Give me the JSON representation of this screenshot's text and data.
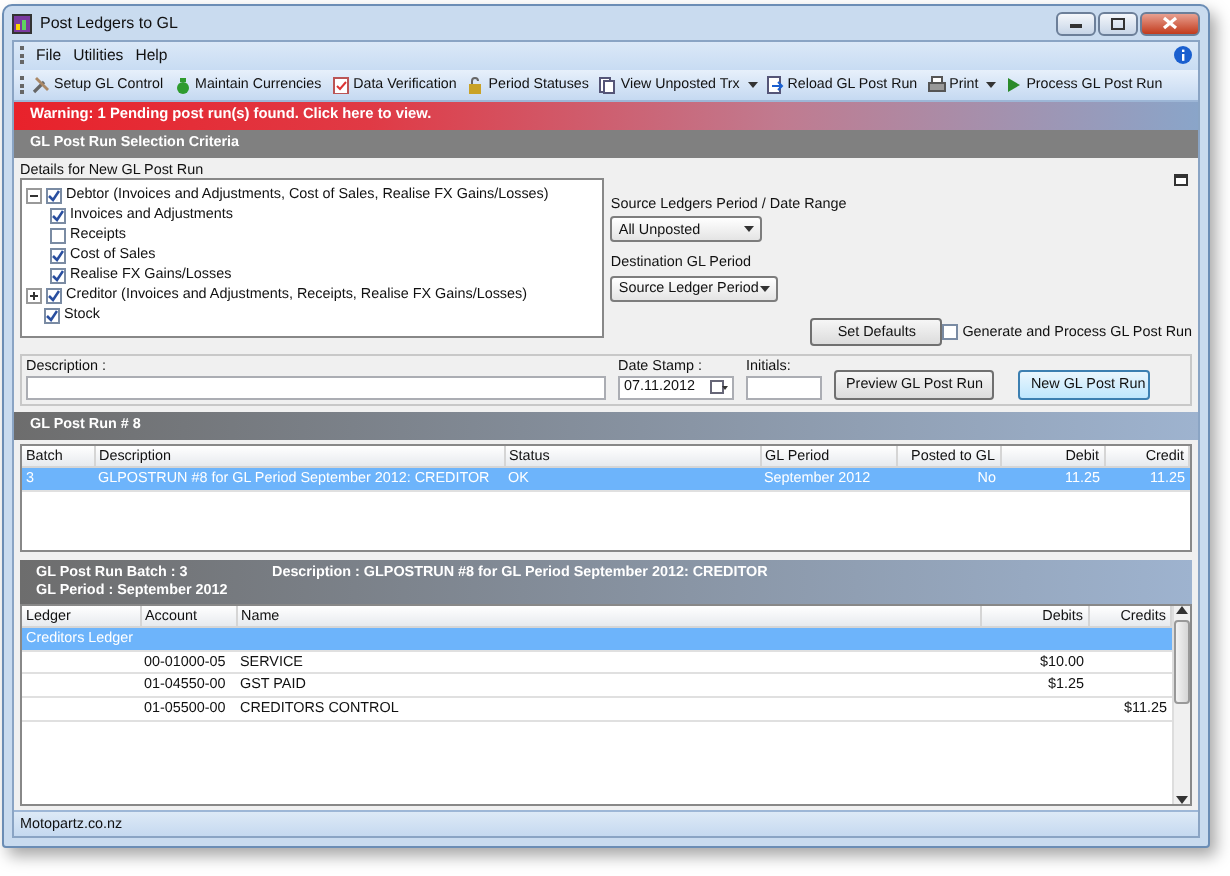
{
  "window": {
    "title": "Post Ledgers to GL"
  },
  "menu": [
    "File",
    "Utilities",
    "Help"
  ],
  "toolbar": [
    {
      "label": "Setup GL Control",
      "dropdown": false
    },
    {
      "label": "Maintain Currencies",
      "dropdown": false
    },
    {
      "label": "Data Verification",
      "dropdown": false
    },
    {
      "label": "Period Statuses",
      "dropdown": false
    },
    {
      "label": "View Unposted Trx",
      "dropdown": true
    },
    {
      "label": "Reload GL Post Run",
      "dropdown": false
    },
    {
      "label": "Print",
      "dropdown": true
    },
    {
      "label": "Process GL Post Run",
      "dropdown": false
    }
  ],
  "warning": "Warning: 1 Pending post run(s) found. Click here to view.",
  "selection_criteria": {
    "title": "GL Post Run Selection Criteria",
    "subtitle": "Details for New GL Post Run",
    "tree": [
      {
        "label": "Debtor (Invoices and Adjustments, Cost of Sales, Realise FX Gains/Losses)",
        "checked": true,
        "expanded": true,
        "children": [
          {
            "label": "Invoices and Adjustments",
            "checked": true
          },
          {
            "label": "Receipts",
            "checked": false
          },
          {
            "label": "Cost of Sales",
            "checked": true
          },
          {
            "label": "Realise FX Gains/Losses",
            "checked": true
          }
        ]
      },
      {
        "label": "Creditor (Invoices and Adjustments, Receipts, Realise FX Gains/Losses)",
        "checked": true,
        "expanded": false
      },
      {
        "label": "Stock",
        "checked": true
      }
    ],
    "source_period": {
      "label": "Source Ledgers Period / Date Range",
      "value": "All Unposted"
    },
    "destination_period": {
      "label": "Destination GL Period",
      "value": "Source Ledger Period"
    },
    "set_defaults": "Set Defaults",
    "generate": {
      "label": "Generate and Process GL Post Run",
      "checked": false
    },
    "description": {
      "label": "Description :"
    },
    "date_stamp": {
      "label": "Date Stamp :",
      "value": "07.11.2012"
    },
    "initials": {
      "label": "Initials:"
    },
    "preview_button": "Preview GL Post Run",
    "new_button": "New GL Post Run"
  },
  "post_run": {
    "title": "GL Post Run # 8",
    "columns": [
      "Batch",
      "Description",
      "Status",
      "GL Period",
      "Posted to GL",
      "Debit",
      "Credit"
    ],
    "rows": [
      {
        "selected": true,
        "cells": [
          "3",
          "GLPOSTRUN #8 for GL Period September 2012: CREDITOR",
          "OK",
          "September 2012",
          "No",
          "11.25",
          "11.25"
        ]
      }
    ]
  },
  "batch": {
    "batch_label": "GL Post Run Batch : 3",
    "description_label": "Description : GLPOSTRUN #8 for GL Period September 2012: CREDITOR",
    "period_label": "GL Period : September 2012",
    "columns": [
      "Ledger",
      "Account",
      "Name",
      "Debits",
      "Credits"
    ],
    "rows": [
      {
        "kind": "group",
        "selected": true,
        "label": "Creditors Ledger"
      },
      {
        "kind": "line",
        "selected": false,
        "cells": [
          "",
          "00-01000-05",
          "SERVICE",
          "$10.00",
          ""
        ]
      },
      {
        "kind": "line",
        "selected": false,
        "cells": [
          "",
          "01-04550-00",
          "GST PAID",
          "$1.25",
          ""
        ]
      },
      {
        "kind": "line",
        "selected": false,
        "cells": [
          "",
          "01-05500-00",
          "CREDITORS CONTROL",
          "",
          "$11.25"
        ]
      }
    ]
  },
  "status_bar": "Motopartz.co.nz"
}
